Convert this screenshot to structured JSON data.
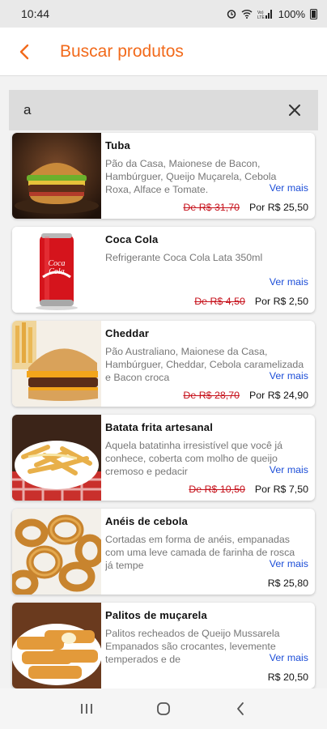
{
  "status": {
    "time": "10:44",
    "battery": "100%"
  },
  "header": {
    "title": "Buscar produtos"
  },
  "search": {
    "value": "a"
  },
  "products": [
    {
      "name": "Tuba",
      "description": "Pão da Casa, Maionese de Bacon, Hambúrguer, Queijo Muçarela, Cebola Roxa, Alface e Tomate.",
      "more": "Ver mais",
      "old_price": "De R$ 31,70",
      "price": "Por R$ 25,50"
    },
    {
      "name": "Coca Cola",
      "description": "Refrigerante Coca Cola Lata 350ml",
      "more": "Ver mais",
      "old_price": "De R$ 4,50",
      "price": "Por R$ 2,50"
    },
    {
      "name": "Cheddar",
      "description": "Pão Australiano, Maionese da Casa, Hambúrguer, Cheddar, Cebola caramelizada e Bacon croca",
      "more": "Ver mais",
      "old_price": "De R$ 28,70",
      "price": "Por R$ 24,90"
    },
    {
      "name": "Batata frita artesanal",
      "description": "Aquela batatinha irresistível que você já conhece, coberta com molho de queijo cremoso e pedacir",
      "more": "Ver mais",
      "old_price": "De R$ 10,50",
      "price": "Por R$ 7,50"
    },
    {
      "name": "Anéis de cebola",
      "description": "Cortadas em forma de anéis, empanadas com uma leve camada de farinha de rosca já tempe",
      "more": "Ver mais",
      "old_price": "",
      "price": "R$ 25,80"
    },
    {
      "name": "Palitos de muçarela",
      "description": "Palitos recheados de Queijo Mussarela Empanados são crocantes, levemente temperados e de",
      "more": "Ver mais",
      "old_price": "",
      "price": "R$ 20,50"
    }
  ],
  "colors": {
    "accent": "#f26a1b",
    "link": "#1e4fd8",
    "strike": "#c6111b"
  }
}
